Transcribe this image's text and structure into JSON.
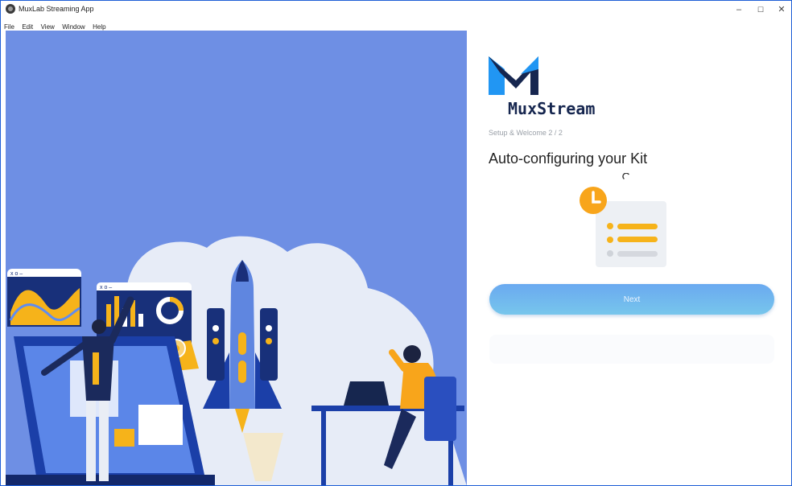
{
  "window": {
    "title": "MuxLab Streaming App",
    "controls": {
      "minimize": "–",
      "maximize": "☐",
      "close": "✕"
    }
  },
  "menu": {
    "items": [
      "File",
      "Edit",
      "View",
      "Window",
      "Help"
    ]
  },
  "brand": {
    "logo_text": "MuxStream",
    "colors": {
      "navy": "#16264f",
      "blue": "#2196f3"
    }
  },
  "setup": {
    "step_label": "Setup & Welcome 2 / 2",
    "heading": "Auto-configuring your Kit",
    "next_label": "Next"
  },
  "illustration": {
    "icons": [
      "dashboard-window-icon",
      "rocket-icon",
      "person-icon",
      "laptop-icon",
      "gear-icon"
    ],
    "colors": {
      "background": "#6e8fe4",
      "accent_yellow": "#f6b31a",
      "accent_orange": "#f8a51b"
    }
  }
}
